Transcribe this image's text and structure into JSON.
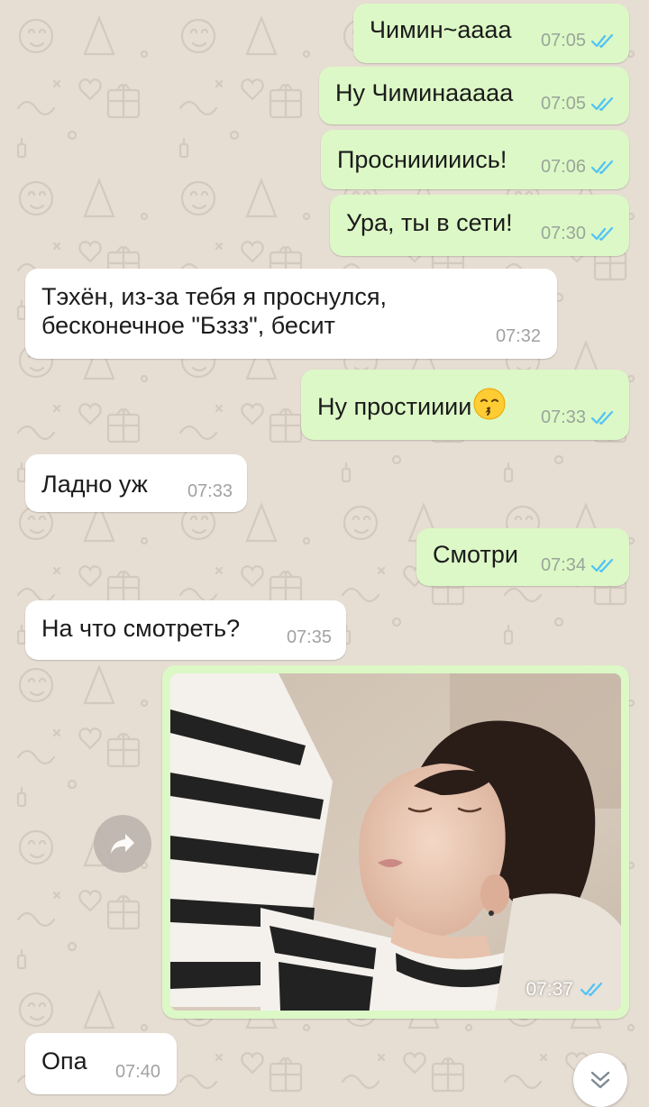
{
  "messages": [
    {
      "dir": "out",
      "text": "Чимин~аааа",
      "time": "07:05",
      "read": true
    },
    {
      "dir": "out",
      "text": "Ну Чиминааааа",
      "time": "07:05",
      "read": true
    },
    {
      "dir": "out",
      "text": "Проснииииись!",
      "time": "07:06",
      "read": true
    },
    {
      "dir": "out",
      "text": "Ура, ты в сети!",
      "time": "07:30",
      "read": true
    },
    {
      "dir": "in",
      "line1": "Тэхён, из-за тебя я проснулся,",
      "line2": "бесконечное \"Бззз\",  бесит",
      "time": "07:32"
    },
    {
      "dir": "out",
      "text": "Ну простииии",
      "emoji": "kissing-face-emoji",
      "time": "07:33",
      "read": true
    },
    {
      "dir": "in",
      "text": "Ладно уж",
      "time": "07:33"
    },
    {
      "dir": "out",
      "text": "Смотри",
      "time": "07:34",
      "read": true
    },
    {
      "dir": "in",
      "text": "На что смотреть?",
      "time": "07:35"
    },
    {
      "dir": "out",
      "type": "image",
      "time": "07:37",
      "read": true
    },
    {
      "dir": "in",
      "text": "Опа",
      "time": "07:40"
    }
  ],
  "colors": {
    "wallpaper": "#e6ddd3",
    "outgoing_bubble": "#dcf8c6",
    "incoming_bubble": "#ffffff",
    "read_ticks": "#4fc3f7"
  },
  "icons": {
    "forward": "forward-arrow-icon",
    "scroll_down": "double-chevron-down-icon",
    "read_status": "double-check-icon"
  }
}
